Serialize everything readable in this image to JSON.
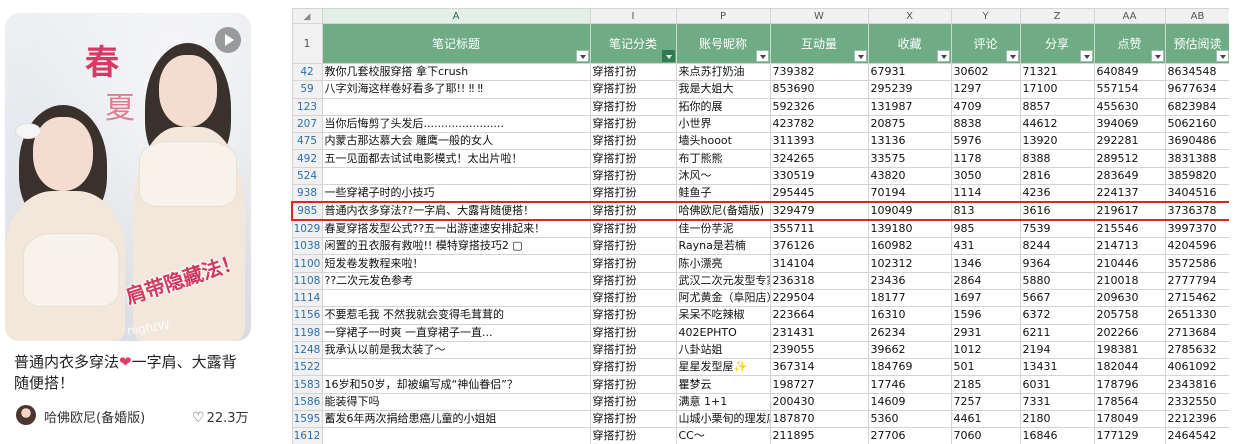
{
  "note_card": {
    "cover_text_spring": "春",
    "cover_text_summer": "夏",
    "cover_overlay": "肩带隐藏法！",
    "cover_watermark": "nightW",
    "title_part1": "普通内衣多穿法",
    "title_emoji": "❤",
    "title_part2": "一字肩、大露背随便搭！",
    "author": "哈佛欧尼(备婚版)",
    "likes": "22.3万",
    "like_icon": "heart-outline-icon"
  },
  "sheet": {
    "column_letters": [
      "",
      "A",
      "I",
      "P",
      "W",
      "X",
      "Y",
      "Z",
      "AA",
      "AB"
    ],
    "header_row_number": "1",
    "fields": [
      "笔记标题",
      "笔记分类",
      "账号昵称",
      "互动量",
      "收藏",
      "评论",
      "分享",
      "点赞",
      "预估阅读"
    ],
    "rows": [
      {
        "n": "42",
        "title": "教你几套校服穿搭 拿下crush",
        "cat": "穿搭打扮",
        "acct": "来点苏打奶油",
        "inter": "739382",
        "fav": "67931",
        "cmt": "30602",
        "share": "71321",
        "like": "640849",
        "read": "8634548"
      },
      {
        "n": "59",
        "title": "八字刘海这样卷好看多了耶!! ‼ ‼",
        "cat": "穿搭打扮",
        "acct": "我是大姐大",
        "inter": "853690",
        "fav": "295239",
        "cmt": "1297",
        "share": "17100",
        "like": "557154",
        "read": "9677634"
      },
      {
        "n": "123",
        "title": "",
        "cat": "穿搭打扮",
        "acct": "拓你的展",
        "inter": "592326",
        "fav": "131987",
        "cmt": "4709",
        "share": "8857",
        "like": "455630",
        "read": "6823984"
      },
      {
        "n": "207",
        "title": "当你后悔剪了头发后.......................",
        "cat": "穿搭打扮",
        "acct": "小世界",
        "inter": "423782",
        "fav": "20875",
        "cmt": "8838",
        "share": "44612",
        "like": "394069",
        "read": "5062160"
      },
      {
        "n": "475",
        "title": "内蒙古那达慕大会 雕鹰一般的女人",
        "cat": "穿搭打扮",
        "acct": "墙头hooot",
        "inter": "311393",
        "fav": "13136",
        "cmt": "5976",
        "share": "13920",
        "like": "292281",
        "read": "3690486"
      },
      {
        "n": "492",
        "title": "五一见面都去试试电影模式！太出片啦！",
        "cat": "穿搭打扮",
        "acct": "布丁熊熊",
        "inter": "324265",
        "fav": "33575",
        "cmt": "1178",
        "share": "8388",
        "like": "289512",
        "read": "3831388"
      },
      {
        "n": "524",
        "title": "",
        "cat": "穿搭打扮",
        "acct": "沐风～",
        "inter": "330519",
        "fav": "43820",
        "cmt": "3050",
        "share": "2816",
        "like": "283649",
        "read": "3859820"
      },
      {
        "n": "938",
        "title": "一些穿裙子时的小技巧",
        "cat": "穿搭打扮",
        "acct": "鲑鱼子",
        "inter": "295445",
        "fav": "70194",
        "cmt": "1114",
        "share": "4236",
        "like": "224137",
        "read": "3404516"
      },
      {
        "n": "985",
        "title": "普通内衣多穿法??一字肩、大露背随便搭！",
        "cat": "穿搭打扮",
        "acct": "哈佛欧尼(备婚版)",
        "inter": "329479",
        "fav": "109049",
        "cmt": "813",
        "share": "3616",
        "like": "219617",
        "read": "3736378",
        "highlight": true
      },
      {
        "n": "1029",
        "title": "春夏穿搭发型公式??五一出游速速安排起来！",
        "cat": "穿搭打扮",
        "acct": "佳一份芋泥",
        "inter": "355711",
        "fav": "139180",
        "cmt": "985",
        "share": "7539",
        "like": "215546",
        "read": "3997370"
      },
      {
        "n": "1038",
        "title": "闲置的丑衣服有救啦!! 模特穿搭技巧2 ▢",
        "cat": "穿搭打扮",
        "acct": "Rayna是若楠",
        "inter": "376126",
        "fav": "160982",
        "cmt": "431",
        "share": "8244",
        "like": "214713",
        "read": "4204596"
      },
      {
        "n": "1100",
        "title": "短发卷发教程来啦！",
        "cat": "穿搭打扮",
        "acct": "陈小漂亮",
        "inter": "314104",
        "fav": "102312",
        "cmt": "1346",
        "share": "9364",
        "like": "210446",
        "read": "3572586"
      },
      {
        "n": "1108",
        "title": "??二次元发色参考",
        "cat": "穿搭打扮",
        "acct": "武汉二次元发型专家",
        "inter": "236318",
        "fav": "23436",
        "cmt": "2864",
        "share": "5880",
        "like": "210018",
        "read": "2777794"
      },
      {
        "n": "1114",
        "title": "",
        "cat": "穿搭打扮",
        "acct": "阿尤黄金（阜阳店）",
        "inter": "229504",
        "fav": "18177",
        "cmt": "1697",
        "share": "5667",
        "like": "209630",
        "read": "2715462"
      },
      {
        "n": "1156",
        "title": "不要惹毛我 不然我就会变得毛茸茸的",
        "cat": "穿搭打扮",
        "acct": "呆呆不吃辣椒",
        "inter": "223664",
        "fav": "16310",
        "cmt": "1596",
        "share": "6372",
        "like": "205758",
        "read": "2651330"
      },
      {
        "n": "1198",
        "title": "一穿裙子一时爽 一直穿裙子一直...",
        "cat": "穿搭打扮",
        "acct": "402EPHTO",
        "inter": "231431",
        "fav": "26234",
        "cmt": "2931",
        "share": "6211",
        "like": "202266",
        "read": "2713684"
      },
      {
        "n": "1248",
        "title": "我承认以前是我太装了～",
        "cat": "穿搭打扮",
        "acct": "八卦站姐",
        "inter": "239055",
        "fav": "39662",
        "cmt": "1012",
        "share": "2194",
        "like": "198381",
        "read": "2785632"
      },
      {
        "n": "1522",
        "title": "",
        "cat": "穿搭打扮",
        "acct": "星星发型屋✨",
        "inter": "367314",
        "fav": "184769",
        "cmt": "501",
        "share": "13431",
        "like": "182044",
        "read": "4061092"
      },
      {
        "n": "1583",
        "title": "16岁和50岁，却被编写成“神仙眷侣”？",
        "cat": "穿搭打扮",
        "acct": "瞿梦云",
        "inter": "198727",
        "fav": "17746",
        "cmt": "2185",
        "share": "6031",
        "like": "178796",
        "read": "2343816"
      },
      {
        "n": "1586",
        "title": "能装得下吗",
        "cat": "穿搭打扮",
        "acct": "满意 1+1",
        "inter": "200430",
        "fav": "14609",
        "cmt": "7257",
        "share": "7331",
        "like": "178564",
        "read": "2332550"
      },
      {
        "n": "1595",
        "title": "蓄发6年两次捐给患癌儿童的小姐姐",
        "cat": "穿搭打扮",
        "acct": "山城小栗旬的理发店",
        "inter": "187870",
        "fav": "5360",
        "cmt": "4461",
        "share": "2180",
        "like": "178049",
        "read": "2212396"
      },
      {
        "n": "1612",
        "title": "",
        "cat": "穿搭打扮",
        "acct": "CC～",
        "inter": "211895",
        "fav": "27706",
        "cmt": "7060",
        "share": "16846",
        "like": "177129",
        "read": "2464542"
      },
      {
        "n": "1654",
        "title": "",
        "cat": "穿搭打扮",
        "acct": "中工网",
        "inter": "180494",
        "fav": "4056",
        "cmt": "1598",
        "share": "743",
        "like": "174840",
        "read": "2146524"
      }
    ]
  }
}
